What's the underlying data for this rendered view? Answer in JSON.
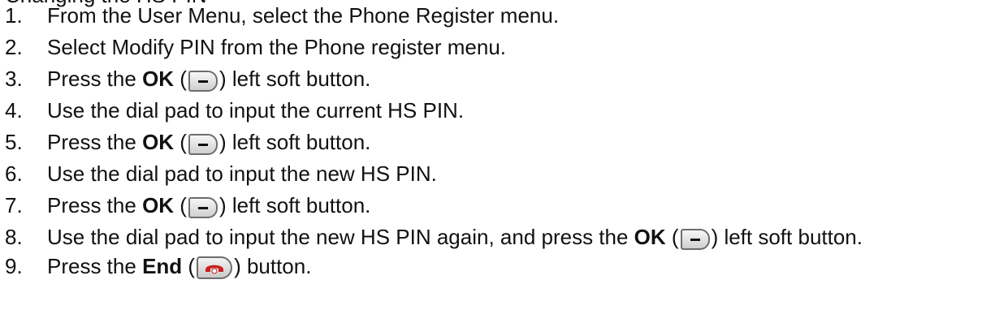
{
  "header_fragment": "Changing the HS PIN",
  "steps": [
    {
      "num": "1.",
      "text": "From the User Menu, select the Phone Register menu."
    },
    {
      "num": "2.",
      "text": "Select Modify PIN from the Phone register menu."
    },
    {
      "num": "3.",
      "pre": "Press the ",
      "bold": "OK",
      "post": ") left soft button."
    },
    {
      "num": "4.",
      "text": "Use the dial pad to input the current HS PIN."
    },
    {
      "num": "5.",
      "pre": "Press the ",
      "bold": "OK",
      "post": ") left soft button."
    },
    {
      "num": "6.",
      "text": "Use the dial pad to input the new HS PIN."
    },
    {
      "num": "7.",
      "pre": "Press the ",
      "bold": "OK",
      "post": ") left soft button."
    },
    {
      "num": "8.",
      "pre": "Use the dial pad to input the new HS PIN again, and press the ",
      "bold": "OK",
      "post": ") left soft button."
    },
    {
      "num": "9.",
      "pre": "Press the ",
      "bold": "End",
      "post": ") button."
    }
  ],
  "icons": {
    "ok_key": "soft-key-minus-icon",
    "end_key": "end-call-red-handset-icon"
  },
  "colors": {
    "end_handset": "#c8201e"
  }
}
